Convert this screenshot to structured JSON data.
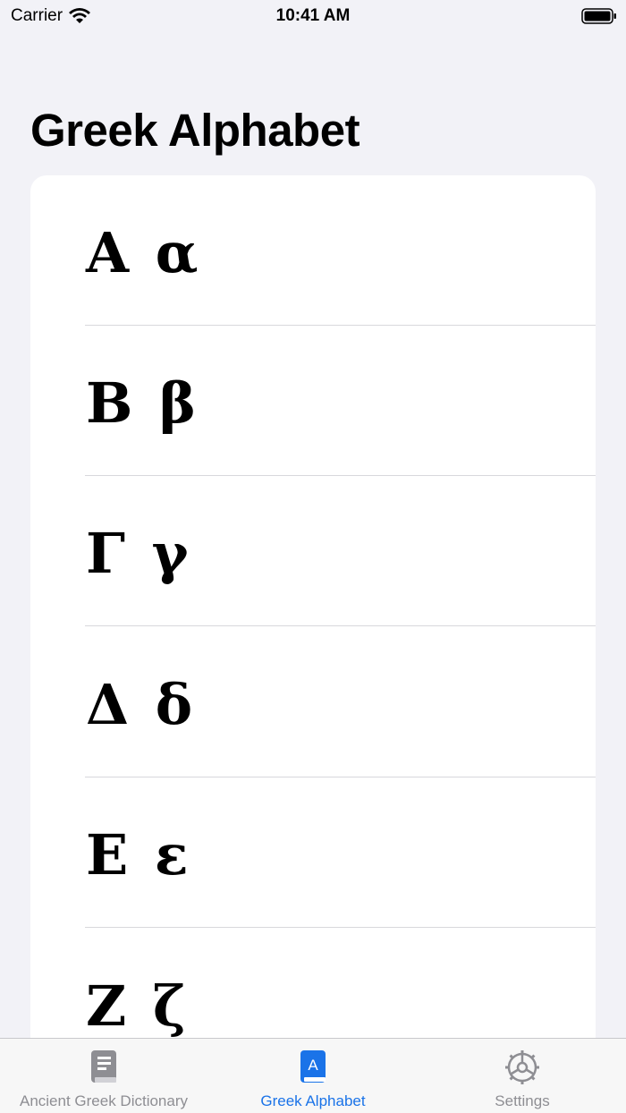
{
  "status_bar": {
    "carrier": "Carrier",
    "time": "10:41 AM"
  },
  "page": {
    "title": "Greek Alphabet"
  },
  "letters": [
    {
      "pair": "Α α"
    },
    {
      "pair": "Β β"
    },
    {
      "pair": "Γ γ"
    },
    {
      "pair": "Δ δ"
    },
    {
      "pair": "Ε ε"
    },
    {
      "pair": "Ζ ζ"
    }
  ],
  "tabs": [
    {
      "label": "Ancient Greek Dictionary",
      "icon": "book-icon",
      "selected": false
    },
    {
      "label": "Greek Alphabet",
      "icon": "alphabet-book-icon",
      "selected": true
    },
    {
      "label": "Settings",
      "icon": "gear-icon",
      "selected": false
    }
  ],
  "colors": {
    "accent": "#1a73e8",
    "inactive": "#8e8e93",
    "background": "#f2f2f7"
  }
}
